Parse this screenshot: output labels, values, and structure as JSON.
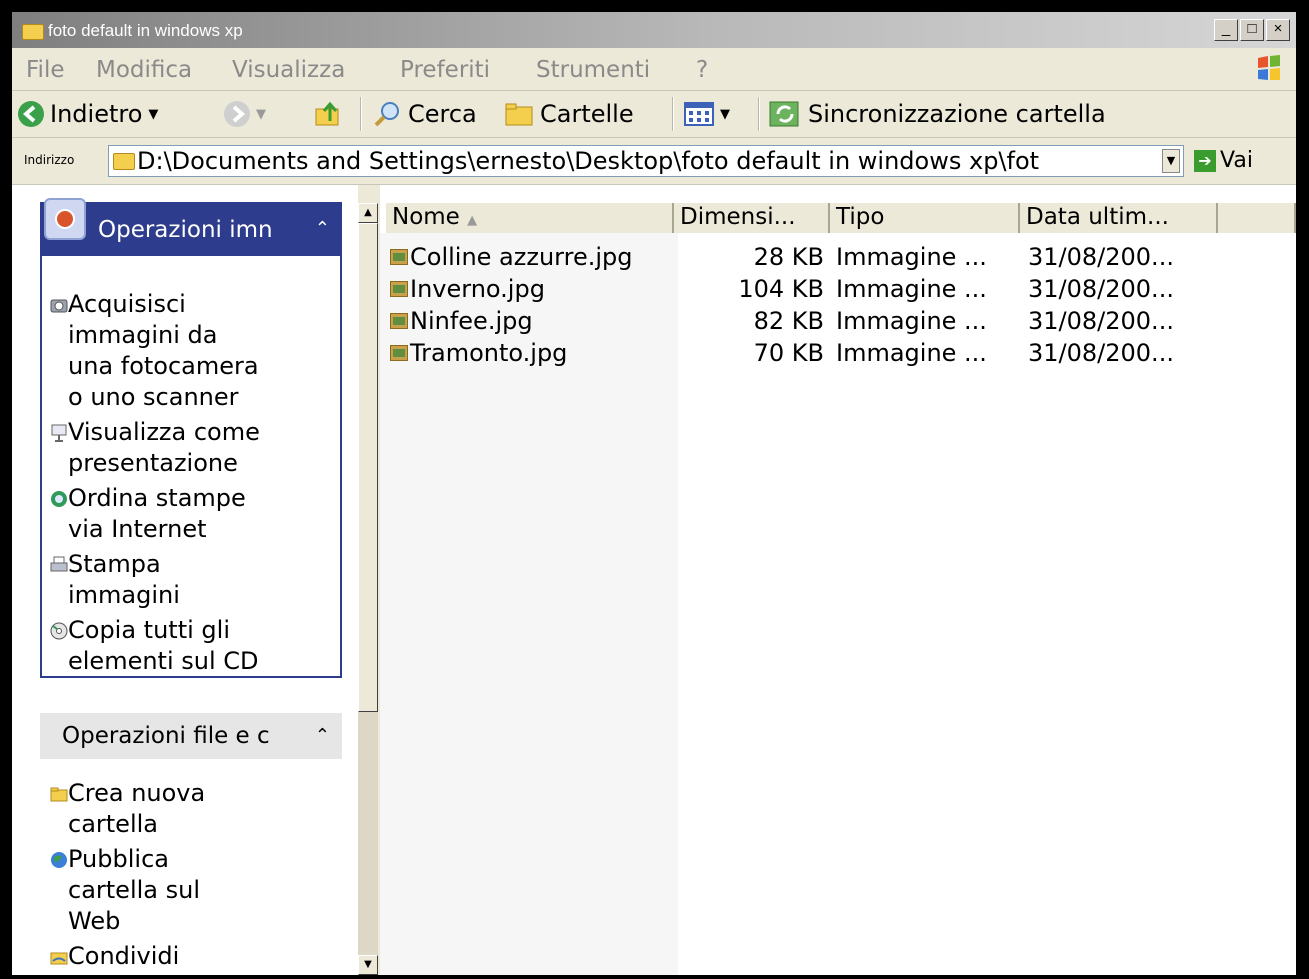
{
  "window": {
    "title": "foto default in windows xp",
    "controls": [
      "_",
      "□",
      "×"
    ]
  },
  "menu": [
    "File",
    "Modifica",
    "Visualizza",
    "Preferiti",
    "Strumenti",
    "?"
  ],
  "toolbar": {
    "back_label": "Indietro",
    "search_label": "Cerca",
    "folders_label": "Cartelle",
    "sync_label": "Sincronizzazione cartella"
  },
  "address": {
    "label": "Indirizzo",
    "value": "D:\\Documents and Settings\\ernesto\\Desktop\\foto default in windows xp\\fot",
    "go_label": "Vai"
  },
  "image_tasks": {
    "title": "Operazioni imn",
    "items": [
      {
        "lines": [
          "Acquisisci",
          "immagini da",
          "una fotocamera",
          "o uno scanner"
        ],
        "icon": "camera-icon"
      },
      {
        "lines": [
          "Visualizza come",
          "presentazione"
        ],
        "icon": "slideshow-icon"
      },
      {
        "lines": [
          "Ordina stampe",
          "via Internet"
        ],
        "icon": "order-prints-icon"
      },
      {
        "lines": [
          "Stampa",
          "immagini"
        ],
        "icon": "printer-icon"
      },
      {
        "lines": [
          "Copia tutti gli",
          "elementi sul CD"
        ],
        "icon": "cd-icon"
      }
    ]
  },
  "file_tasks": {
    "title": "Operazioni file e c",
    "items": [
      {
        "lines": [
          "Crea nuova",
          "cartella"
        ],
        "icon": "new-folder-icon"
      },
      {
        "lines": [
          "Pubblica",
          "cartella sul",
          "Web"
        ],
        "icon": "globe-icon"
      },
      {
        "lines": [
          "Condividi"
        ],
        "icon": "share-icon"
      }
    ]
  },
  "columns": {
    "name": "Nome",
    "size": "Dimensi...",
    "type": "Tipo",
    "date": "Data ultim..."
  },
  "files": [
    {
      "name": "Colline azzurre.jpg",
      "size": "28 KB",
      "type": "Immagine ...",
      "date": "31/08/200..."
    },
    {
      "name": "Inverno.jpg",
      "size": "104 KB",
      "type": "Immagine ...",
      "date": "31/08/200..."
    },
    {
      "name": "Ninfee.jpg",
      "size": "82 KB",
      "type": "Immagine ...",
      "date": "31/08/200..."
    },
    {
      "name": "Tramonto.jpg",
      "size": "70 KB",
      "type": "Immagine ...",
      "date": "31/08/200..."
    }
  ],
  "colors": {
    "task_header": "#2d3c8c",
    "titlebar_inactive": "#a0a0a0",
    "window_bg": "#ece9d8"
  }
}
